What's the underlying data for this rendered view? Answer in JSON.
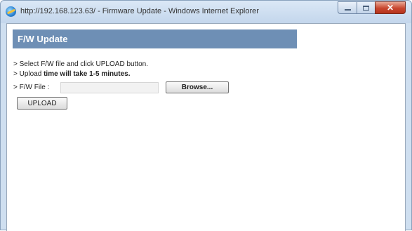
{
  "window": {
    "title": "http://192.168.123.63/ - Firmware Update - Windows Internet Explorer"
  },
  "panel": {
    "title": "F/W Update"
  },
  "instructions": {
    "line1": "> Select F/W file and click UPLOAD button.",
    "line2_prefix": "> Upload ",
    "line2_bold": "time will take 1-5 minutes.",
    "file_label": "> F/W File :"
  },
  "form": {
    "file_value": "",
    "browse_label": "Browse...",
    "upload_label": "UPLOAD"
  },
  "icons": {
    "app": "ie-icon",
    "minimize": "minimize-icon",
    "maximize": "maximize-icon",
    "close": "close-icon"
  }
}
